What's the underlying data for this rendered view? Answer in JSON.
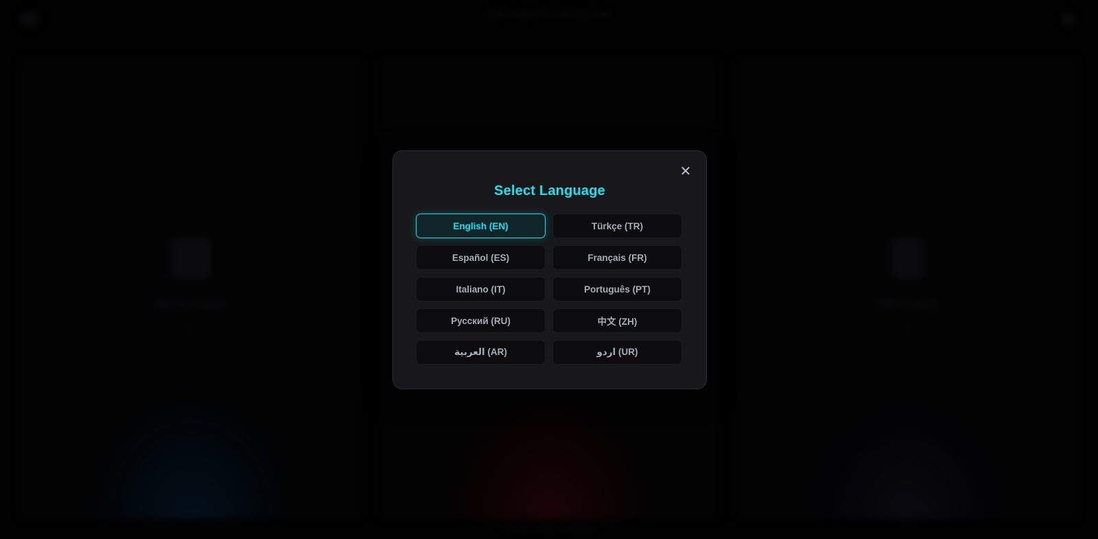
{
  "background": {
    "header_title": "MULTIMEDYA ARAÇLARI",
    "cards": [
      {
        "title": "Resim Araçları"
      },
      {
        "title": ""
      },
      {
        "title": "PDF Araçları"
      }
    ],
    "bottom_caption": "Ses ve Video Araçları"
  },
  "modal": {
    "title": "Select Language",
    "close_icon": "close-icon",
    "accent_color": "#17e4f2",
    "selected": "EN",
    "languages": [
      {
        "code": "EN",
        "label": "English (EN)"
      },
      {
        "code": "TR",
        "label": "Türkçe (TR)"
      },
      {
        "code": "ES",
        "label": "Español (ES)"
      },
      {
        "code": "FR",
        "label": "Français (FR)"
      },
      {
        "code": "IT",
        "label": "Italiano (IT)"
      },
      {
        "code": "PT",
        "label": "Português (PT)"
      },
      {
        "code": "RU",
        "label": "Русский (RU)"
      },
      {
        "code": "ZH",
        "label": "中文 (ZH)"
      },
      {
        "code": "AR",
        "label": "العربية (AR)"
      },
      {
        "code": "UR",
        "label": "اردو (UR)"
      }
    ]
  }
}
